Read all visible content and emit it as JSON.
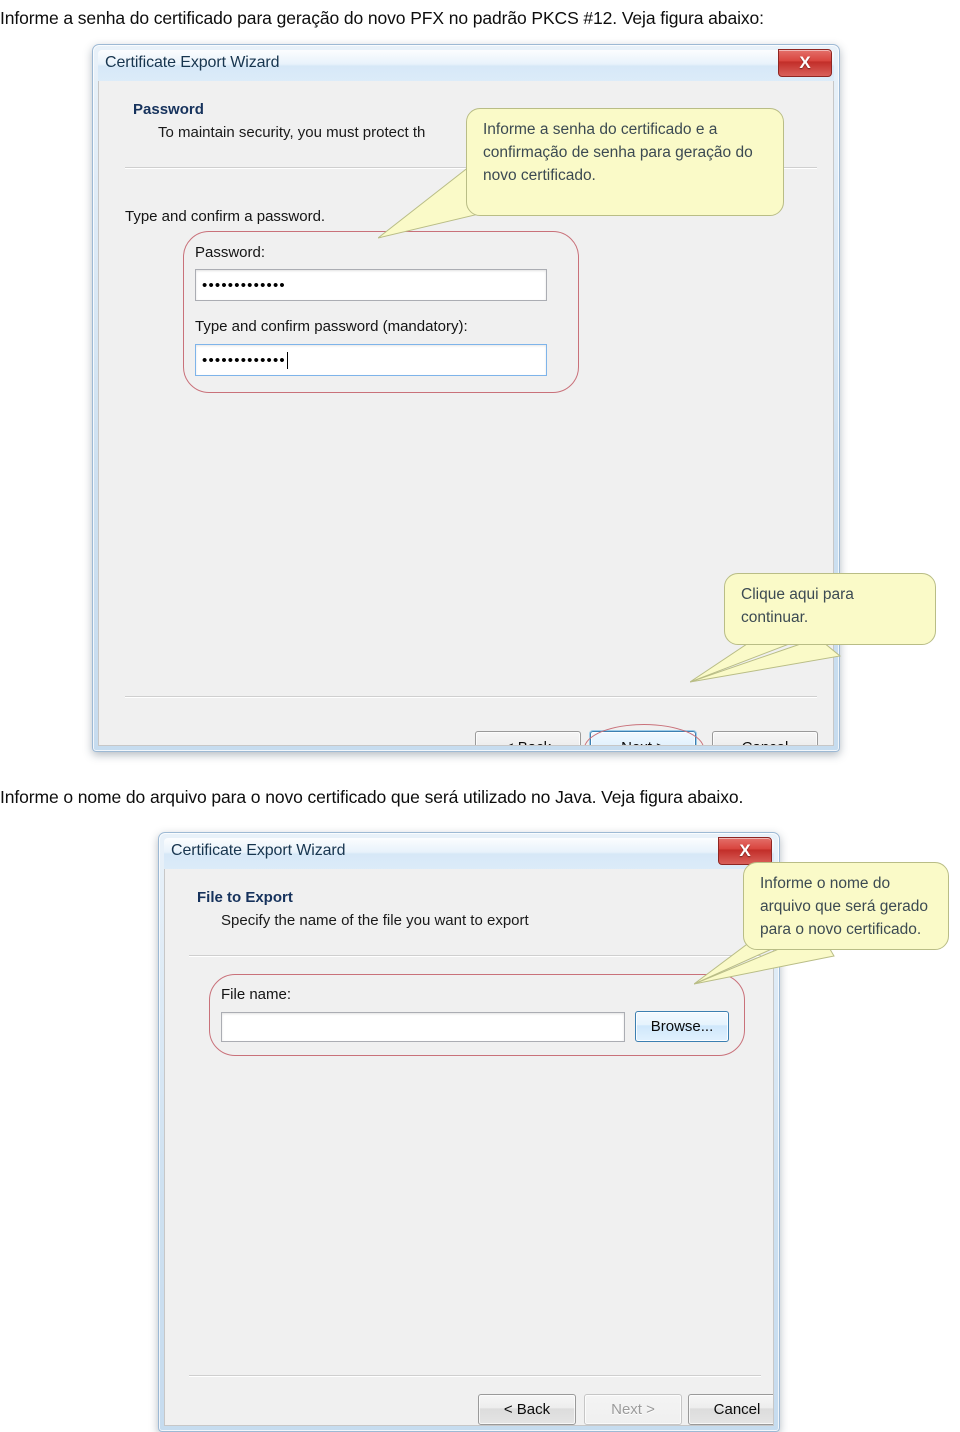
{
  "document": {
    "paragraph_top": "Informe a senha do certificado para geração do novo PFX no padrão PKCS #12. Veja figura abaixo:",
    "paragraph_middle": "Informe o nome do arquivo para o novo certificado que será utilizado no Java. Veja figura abaixo."
  },
  "dialog_password": {
    "title": "Certificate Export Wizard",
    "close_label": "X",
    "heading": "Password",
    "subheading": "To maintain security, you must protect th",
    "instruction": "Type and confirm a password.",
    "password_label": "Password:",
    "password_value": "•••••••••••••",
    "confirm_label": "Type and confirm password (mandatory):",
    "confirm_value": "•••••••••••••",
    "buttons": {
      "back": "< Back",
      "next": "Next >",
      "cancel": "Cancel"
    },
    "callout_password": "Informe a senha do certificado e a confirmação de senha para geração do novo certificado.",
    "callout_next": "Clique aqui para continuar."
  },
  "dialog_file": {
    "title": "Certificate Export Wizard",
    "close_label": "X",
    "heading": "File to Export",
    "subheading": "Specify the name of the file you want to export",
    "file_name_label": "File name:",
    "file_name_value": "",
    "browse_label": "Browse...",
    "buttons": {
      "back": "< Back",
      "next": "Next >",
      "cancel": "Cancel"
    },
    "callout_file": "Informe o nome do arquivo que será gerado para o novo certificado."
  },
  "colors": {
    "annotation_red": "#c9717a",
    "callout_fill": "#fafac8",
    "callout_border": "#b9bd86",
    "callout_text": "#3c4a52",
    "dialog_face": "#f0f0f0",
    "title_text": "#17354f"
  }
}
